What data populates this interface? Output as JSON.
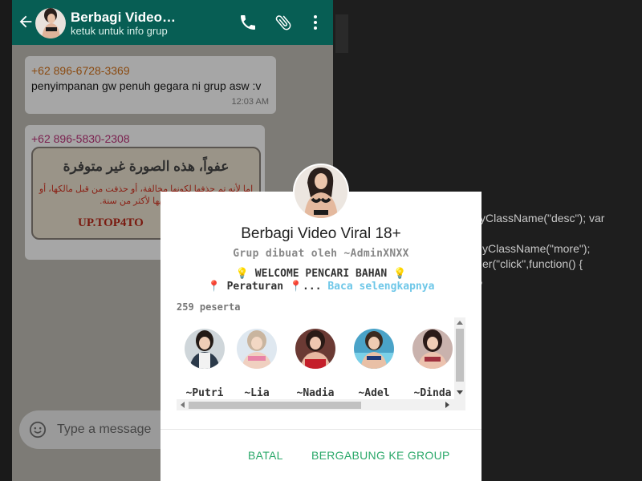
{
  "background_code": {
    "line1": "yClassName(\"desc\"); var",
    "line2": "yClassName(\"more\");",
    "line3": "er(\"click\",function() {",
    "line4": ","
  },
  "chat_header": {
    "title": "Berbagi Video…",
    "subtitle": "ketuk untuk info grup",
    "color": "#075e54"
  },
  "messages": [
    {
      "sender": "+62 896-6728-3369",
      "text": "penyimpanan gw penuh gegara ni grup asw :v",
      "time": "12:03 AM"
    },
    {
      "sender": "+62 896-5830-2308",
      "image_text": {
        "arabic": "عفواً، هذه الصورة غير متوفرة",
        "notice": "إما لأنه تم حذفها لكونها مخالفة، أو حذفت من قبل مالكها، أو مضى عليها لأكثر من سنة.",
        "domain": "UP.TOP4TO"
      }
    }
  ],
  "compose": {
    "placeholder": "Type a message"
  },
  "dialog": {
    "title": "Berbagi Video Viral 18+",
    "creator": "Grup dibuat oleh ~AdminXNXX",
    "desc_line1": "💡 WELCOME PENCARI BAHAN 💡",
    "desc_line2_prefix": "📍 Peraturan 📍... ",
    "read_more": "Baca selengkapnya",
    "members_count": "259 peserta",
    "members": [
      {
        "name": "~Putri"
      },
      {
        "name": "~Lia"
      },
      {
        "name": "~Nadia"
      },
      {
        "name": "~Adel"
      },
      {
        "name": "~Dinda"
      }
    ],
    "cancel_label": "BATAL",
    "join_label": "BERGABUNG KE GROUP",
    "accent_color": "#2aa869"
  }
}
